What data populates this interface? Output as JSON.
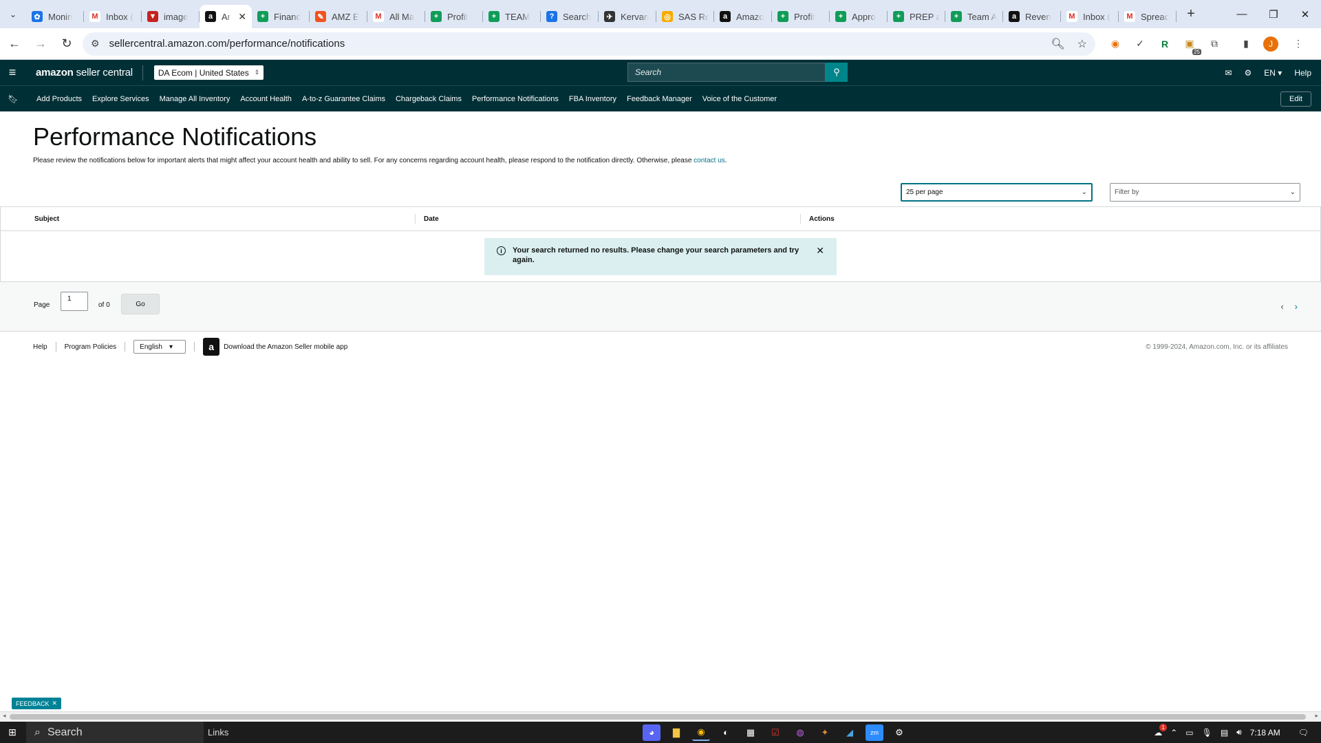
{
  "browser": {
    "tabs": [
      {
        "label": "Monin",
        "fav_color": "#1a73e8",
        "fav_glyph": "✿"
      },
      {
        "label": "Inbox (",
        "fav_color": "#ffffff",
        "fav_glyph": "M"
      },
      {
        "label": "image",
        "fav_color": "#c5221f",
        "fav_glyph": "▼"
      },
      {
        "label": "Ar",
        "fav_color": "#111111",
        "fav_glyph": "a",
        "active": true
      },
      {
        "label": "Financ",
        "fav_color": "#0f9d58",
        "fav_glyph": "+"
      },
      {
        "label": "AMZ E",
        "fav_color": "#f4511e",
        "fav_glyph": "✎"
      },
      {
        "label": "All Ma",
        "fav_color": "#ffffff",
        "fav_glyph": "M"
      },
      {
        "label": "Profit",
        "fav_color": "#0f9d58",
        "fav_glyph": "+"
      },
      {
        "label": "TEAM",
        "fav_color": "#0f9d58",
        "fav_glyph": "+"
      },
      {
        "label": "Search",
        "fav_color": "#1a73e8",
        "fav_glyph": "?"
      },
      {
        "label": "Kervan",
        "fav_color": "#333333",
        "fav_glyph": "✈"
      },
      {
        "label": "SAS Re",
        "fav_color": "#f9ab00",
        "fav_glyph": "◎"
      },
      {
        "label": "Amazo",
        "fav_color": "#111111",
        "fav_glyph": "a"
      },
      {
        "label": "Profit",
        "fav_color": "#0f9d58",
        "fav_glyph": "+"
      },
      {
        "label": "Appro",
        "fav_color": "#0f9d58",
        "fav_glyph": "+"
      },
      {
        "label": "PREP a",
        "fav_color": "#0f9d58",
        "fav_glyph": "+"
      },
      {
        "label": "Team A",
        "fav_color": "#0f9d58",
        "fav_glyph": "+"
      },
      {
        "label": "Reven",
        "fav_color": "#111111",
        "fav_glyph": "a"
      },
      {
        "label": "Inbox (",
        "fav_color": "#ffffff",
        "fav_glyph": "M"
      },
      {
        "label": "Spreac",
        "fav_color": "#ffffff",
        "fav_glyph": "M"
      }
    ],
    "url": "sellercentral.amazon.com/performance/notifications"
  },
  "header": {
    "logo_main": "amazon",
    "logo_sub": "seller central",
    "account": "DA Ecom | United States",
    "search_placeholder": "Search",
    "lang": "EN",
    "help": "Help"
  },
  "nav": {
    "items": [
      "Add Products",
      "Explore Services",
      "Manage All Inventory",
      "Account Health",
      "A-to-z Guarantee Claims",
      "Chargeback Claims",
      "Performance Notifications",
      "FBA Inventory",
      "Feedback Manager",
      "Voice of the Customer"
    ],
    "edit": "Edit"
  },
  "page": {
    "title": "Performance Notifications",
    "description": "Please review the notifications below for important alerts that might affect your account health and ability to sell. For any concerns regarding account health, please respond to the notification directly. Otherwise, please",
    "contact_link": "contact us",
    "per_page": "25 per page",
    "filter_by": "Filter by"
  },
  "table": {
    "columns": [
      "Subject",
      "Date",
      "Actions"
    ],
    "alert": "Your search returned no results. Please change your search parameters and try again."
  },
  "pager": {
    "page_label": "Page",
    "page_value": "1",
    "of_label": "of 0",
    "go": "Go"
  },
  "footer": {
    "help": "Help",
    "policies": "Program Policies",
    "language": "English",
    "app_text": "Download the Amazon Seller mobile app",
    "copyright": "© 1999-2024, Amazon.com, Inc. or its affiliates"
  },
  "feedback": "FEEDBACK",
  "taskbar": {
    "search": "Search",
    "links": "Links",
    "time": "7:18 AM",
    "ext_badge": "25",
    "notif_badge": "1"
  },
  "colors": {
    "header_bg": "#002f36",
    "accent": "#007185",
    "alert_bg": "#dbeff0"
  }
}
